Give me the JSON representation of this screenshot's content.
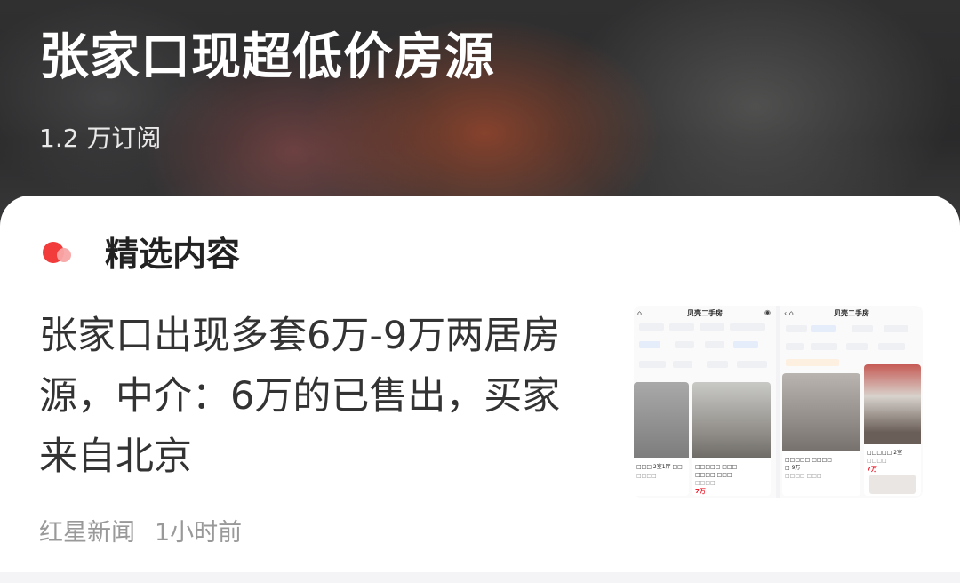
{
  "header": {
    "title": "张家口现超低价房源",
    "subscribers": "1.2 万订阅"
  },
  "section": {
    "title": "精选内容"
  },
  "article": {
    "title": "张家口出现多套6万-9万两居房源，中介：6万的已售出，买家来自北京",
    "source": "红星新闻",
    "time": "1小时前",
    "thumbnail": {
      "left_screen_title": "贝壳二手房",
      "right_screen_title": "贝壳二手房",
      "left_price": "7万",
      "right_price_1": "9万",
      "right_price_2": "7万"
    }
  },
  "colors": {
    "accent_red": "#f23c3c",
    "text_dark": "#333333",
    "text_meta": "#999999"
  }
}
